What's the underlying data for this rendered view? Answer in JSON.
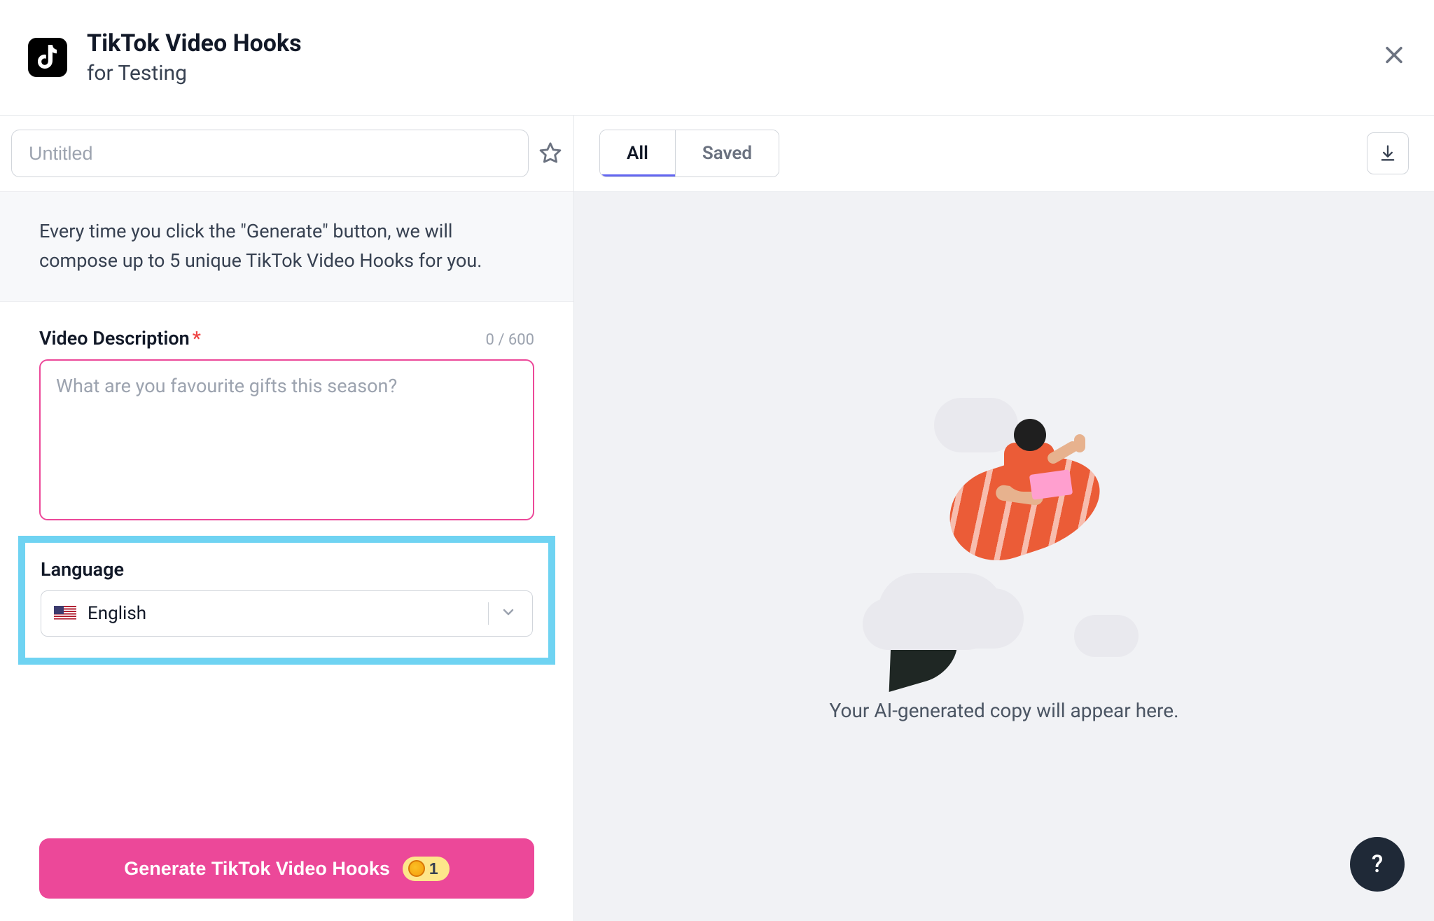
{
  "header": {
    "title": "TikTok Video Hooks",
    "subtitle": "for Testing"
  },
  "left": {
    "title_placeholder": "Untitled",
    "description_banner": "Every time you click the \"Generate\" button, we will compose up to 5 unique TikTok Video Hooks for you.",
    "video_desc": {
      "label": "Video Description",
      "counter": "0 / 600",
      "placeholder": "What are you favourite gifts this season?"
    },
    "language": {
      "label": "Language",
      "selected": "English"
    },
    "generate_button": {
      "label": "Generate TikTok Video Hooks",
      "cost": "1"
    }
  },
  "right": {
    "tabs": {
      "all": "All",
      "saved": "Saved"
    },
    "empty_text": "Your AI-generated copy will appear here."
  },
  "help_label": "?"
}
